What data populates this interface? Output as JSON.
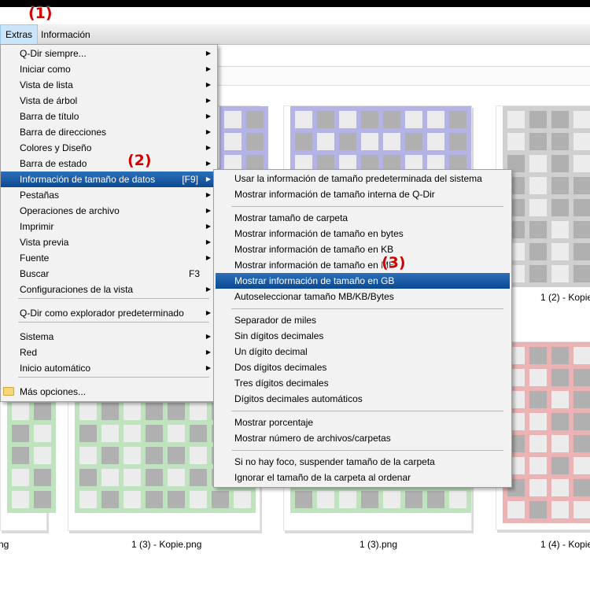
{
  "markers": {
    "m1": "(1)",
    "m2": "(2)",
    "m3": "(3)"
  },
  "menubar": {
    "extras": "Extras",
    "info": "Información"
  },
  "extras_menu": {
    "items": [
      "Q-Dir siempre...",
      "Iniciar como",
      "Vista de lista",
      "Vista de árbol",
      "Barra de título",
      "Barra de direcciones",
      "Colores y Diseño",
      "Barra de estado",
      "Información de tamaño de datos",
      "Pestañas",
      "Operaciones de archivo",
      "Imprimir",
      "Vista previa",
      "Fuente",
      "Buscar",
      "Configuraciones de la vista",
      "Q-Dir como explorador predeterminado",
      "Sistema",
      "Red",
      "Inicio automático",
      "Más opciones..."
    ],
    "shortcut_size": "[F9]",
    "shortcut_search": "F3"
  },
  "size_submenu": {
    "items": [
      "Usar la información de tamaño predeterminada del sistema",
      "Mostrar información de tamaño interna de Q-Dir",
      "Mostrar tamaño de carpeta",
      "Mostrar información de tamaño en bytes",
      "Mostrar información de tamaño en KB",
      "Mostrar información de tamaño en MB",
      "Mostrar información de tamaño en GB",
      "Autoseleccionar tamaño MB/KB/Bytes",
      "Separador de miles",
      "Sin dígitos decimales",
      "Un dígito decimal",
      "Dos dígitos decimales",
      "Tres dígitos decimales",
      "Dígitos decimales automáticos",
      "Mostrar porcentaje",
      "Mostrar número de archivos/carpetas",
      "Si no hay foco, suspender tamaño de la carpeta",
      "Ignorar el tamaño de la carpeta al ordenar"
    ]
  },
  "files": [
    {
      "name": "1 (2) - Kopie"
    },
    {
      "name": "ng"
    },
    {
      "name": "1 (3) - Kopie.png"
    },
    {
      "name": "1 (3).png"
    },
    {
      "name": "1 (4) - Kopie"
    }
  ],
  "colors": {
    "blue": "#b3b3e6",
    "gray": "#cfcfcf",
    "green": "#bfe3bf",
    "red": "#ebb3b3",
    "cell_gray": "#b0b0b0",
    "cell_light": "#ececec"
  }
}
